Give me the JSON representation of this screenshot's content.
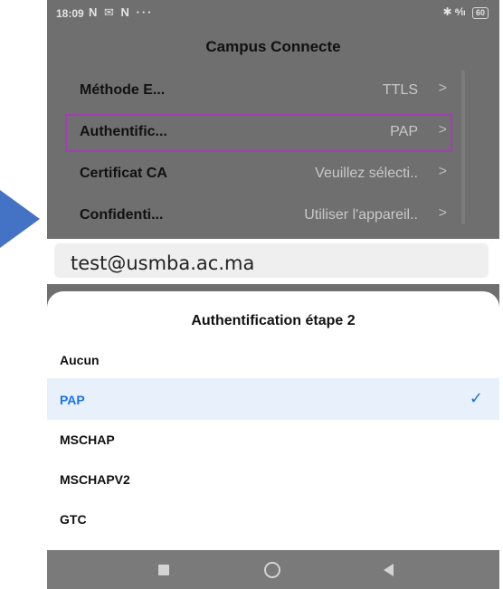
{
  "status_bar": {
    "time": "18:09",
    "left_icons": "N ✉ N ···",
    "right_icons": "✱ ᵃ⁄ₗₗ",
    "battery": "60"
  },
  "page": {
    "title": "Campus Connecte",
    "rows": [
      {
        "label": "Méthode E...",
        "value": "TTLS",
        "chevron": ">"
      },
      {
        "label": "Authentific...",
        "value": "PAP",
        "chevron": ">"
      },
      {
        "label": "Certificat CA",
        "value": "Veuillez sélecti..",
        "chevron": ">"
      },
      {
        "label": "Confidenti...",
        "value": "Utiliser l'appareil..",
        "chevron": ">"
      }
    ]
  },
  "email_overlay": {
    "value": "test@usmba.ac.ma"
  },
  "sheet": {
    "title": "Authentification étape 2",
    "options": [
      {
        "label": "Aucun"
      },
      {
        "label": "PAP",
        "selected": true,
        "check": "✓"
      },
      {
        "label": "MSCHAP"
      },
      {
        "label": "MSCHAPV2"
      },
      {
        "label": "GTC"
      }
    ]
  },
  "colors": {
    "accent": "#1a73e8",
    "highlight_border": "#a040b0",
    "pointer_arrow": "#4472c4",
    "dimmed_background": "#6f6f6f"
  }
}
